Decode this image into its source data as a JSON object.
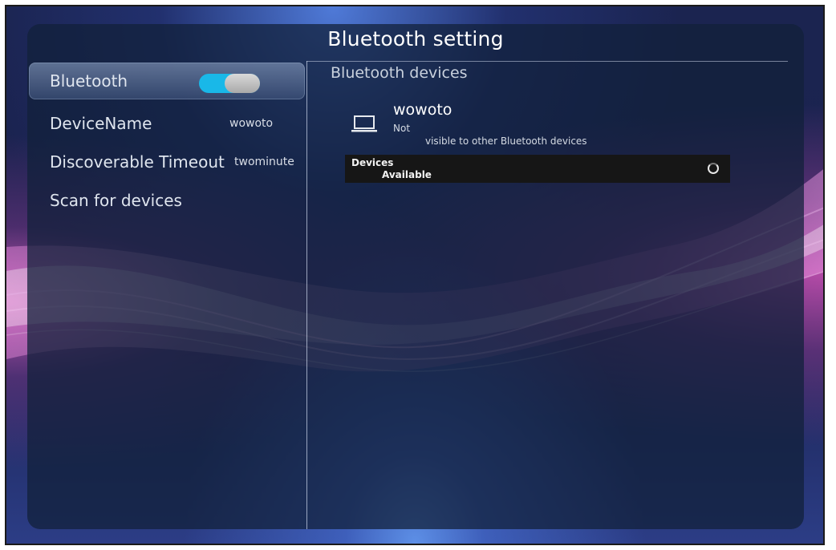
{
  "window": {
    "title": "Bluetooth setting"
  },
  "sidebar": {
    "items": [
      {
        "label": "Bluetooth",
        "value": "",
        "toggle": "on",
        "selected": true
      },
      {
        "label": "DeviceName",
        "value": "wowoto"
      },
      {
        "label": "Discoverable Timeout",
        "value": "twominute"
      },
      {
        "label": "Scan for devices",
        "value": ""
      }
    ]
  },
  "main": {
    "section_title": "Bluetooth devices",
    "device": {
      "icon": "laptop-icon",
      "name": "wowoto",
      "status_line1": "Not",
      "status_line2": "visible to other Bluetooth devices"
    },
    "available": {
      "line1": "Devices",
      "line2": "Available",
      "icon": "spinner-icon"
    }
  },
  "colors": {
    "toggle_on": "#19b8e8",
    "panel": "#12203a"
  }
}
